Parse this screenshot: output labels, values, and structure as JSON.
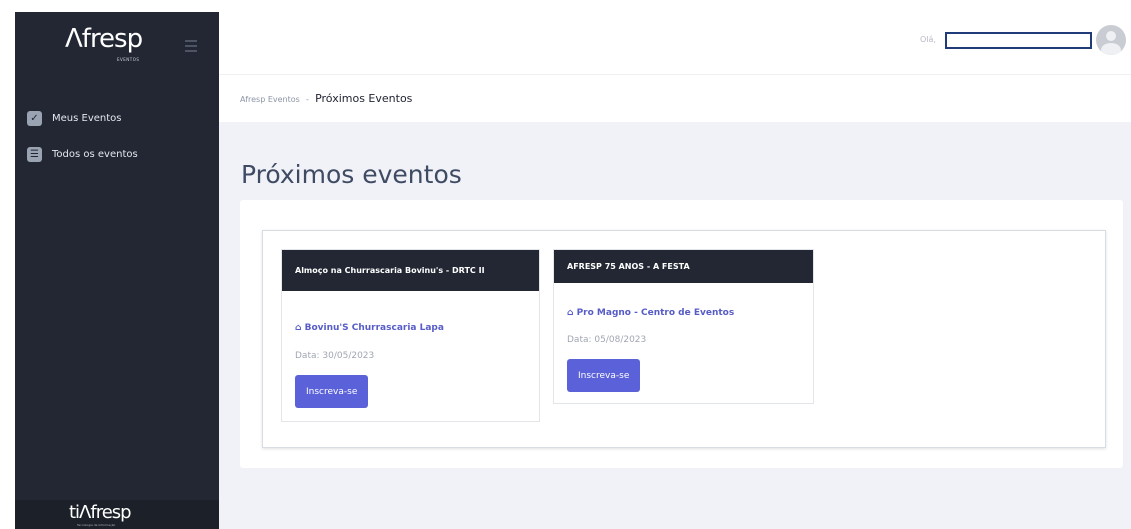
{
  "sidebar": {
    "logo": "Λfresp",
    "logo_sub": "EVENTOS",
    "items": [
      {
        "label": "Meus Eventos",
        "icon": "check-icon"
      },
      {
        "label": "Todos os eventos",
        "icon": "list-icon"
      }
    ],
    "footer_logo": "tiΛfresp",
    "footer_sub": "Tecnologia da Informação"
  },
  "topbar": {
    "greeting": "Olá,"
  },
  "breadcrumb": {
    "root": "Afresp Eventos",
    "separator": "-",
    "current": "Próximos Eventos"
  },
  "main": {
    "title": "Próximos eventos",
    "events": [
      {
        "title": "Almoço na Churrascaria Bovinu's - DRTC II",
        "venue": "Bovinu'S Churrascaria Lapa",
        "date": "Data: 30/05/2023",
        "button": "Inscreva-se"
      },
      {
        "title": "AFRESP 75 ANOS - A FESTA",
        "venue": "Pro Magno - Centro de Eventos",
        "date": "Data: 05/08/2023",
        "button": "Inscreva-se"
      }
    ]
  },
  "colors": {
    "sidebar_bg": "#222733",
    "main_bg": "#f0f2f7",
    "accent": "#5b62d9",
    "venue_text": "#575cc6",
    "title_text": "#3f4a63"
  }
}
